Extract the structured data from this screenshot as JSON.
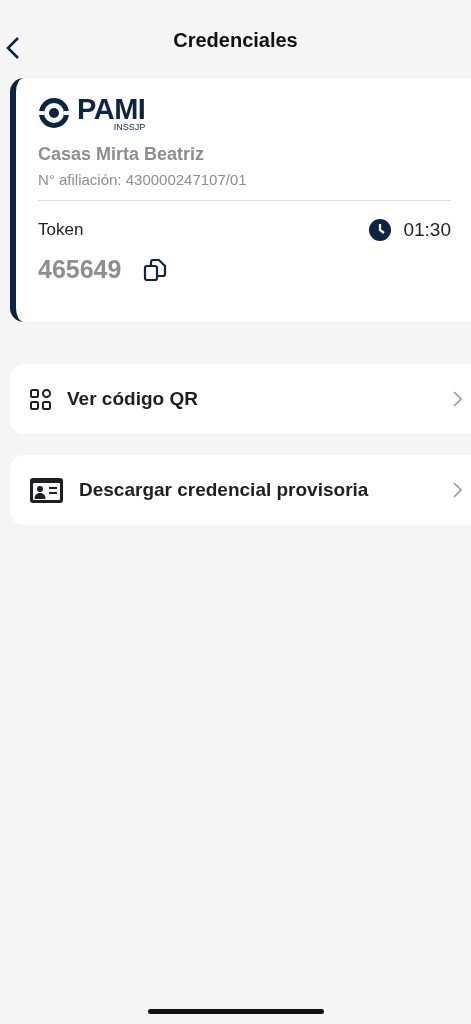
{
  "header": {
    "title": "Credenciales"
  },
  "card": {
    "logo": {
      "name": "PAMI",
      "subtitle": "INSSJP"
    },
    "member_name": "Casas Mirta Beatriz",
    "affiliate_number": "N° afiliación: 430000247107/01",
    "token_label": "Token",
    "timer": "01:30",
    "token": "465649"
  },
  "menu": [
    {
      "kind": "qr",
      "label": "Ver código QR"
    },
    {
      "kind": "id-card",
      "label": "Descargar credencial provisoria"
    }
  ]
}
